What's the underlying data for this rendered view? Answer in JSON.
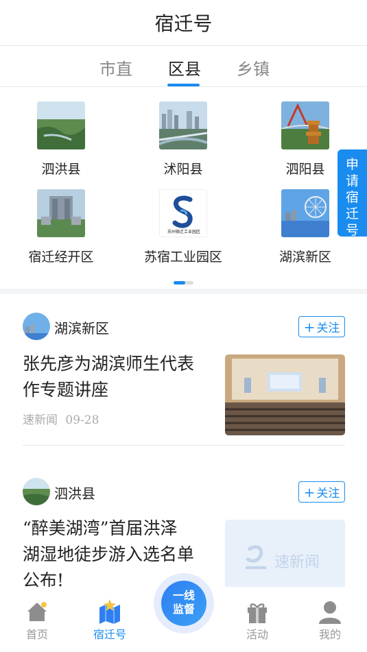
{
  "header": {
    "title": "宿迁号"
  },
  "tabs": [
    {
      "label": "市直",
      "active": false
    },
    {
      "label": "区县",
      "active": true
    },
    {
      "label": "乡镇",
      "active": false
    }
  ],
  "districts": [
    {
      "label": "泗洪县",
      "image": "wetland-forest"
    },
    {
      "label": "沭阳县",
      "image": "city-bridge"
    },
    {
      "label": "泗阳县",
      "image": "pagoda-bridge"
    },
    {
      "label": "宿迁经开区",
      "image": "government-building"
    },
    {
      "label": "苏宿工业园区",
      "image": "industrial-park-logo",
      "logo_text": "苏州宿迁工业园区"
    },
    {
      "label": "湖滨新区",
      "image": "lakeside-ferris-wheel"
    }
  ],
  "apply_button": {
    "label": [
      "申",
      "请",
      "宿",
      "迁",
      "号"
    ]
  },
  "feed": [
    {
      "source": "湖滨新区",
      "follow_label": "关注",
      "headline": [
        "张先彦为湖滨师生代表",
        "作专题讲座"
      ],
      "meta_source": "速新闻",
      "meta_date": "09-28",
      "image": "lecture-hall"
    },
    {
      "source": "泗洪县",
      "follow_label": "关注",
      "headline": [
        "“醉美湖湾”首届洪泽",
        "湖湿地徒步游入选名单",
        "公布!"
      ],
      "image": "placeholder-logo",
      "placeholder_text": "速新闻"
    }
  ],
  "bottom_nav": [
    {
      "label": "首页",
      "icon": "home-icon",
      "active": false
    },
    {
      "label": "宿迁号",
      "icon": "map-star-icon",
      "active": true
    },
    {
      "label": "活动",
      "icon": "gift-icon",
      "active": false
    },
    {
      "label": "我的",
      "icon": "user-icon",
      "active": false
    }
  ],
  "center_button": {
    "line1": "一线",
    "line2": "监督"
  },
  "colors": {
    "accent": "#1a8cf0",
    "muted": "#999999"
  }
}
